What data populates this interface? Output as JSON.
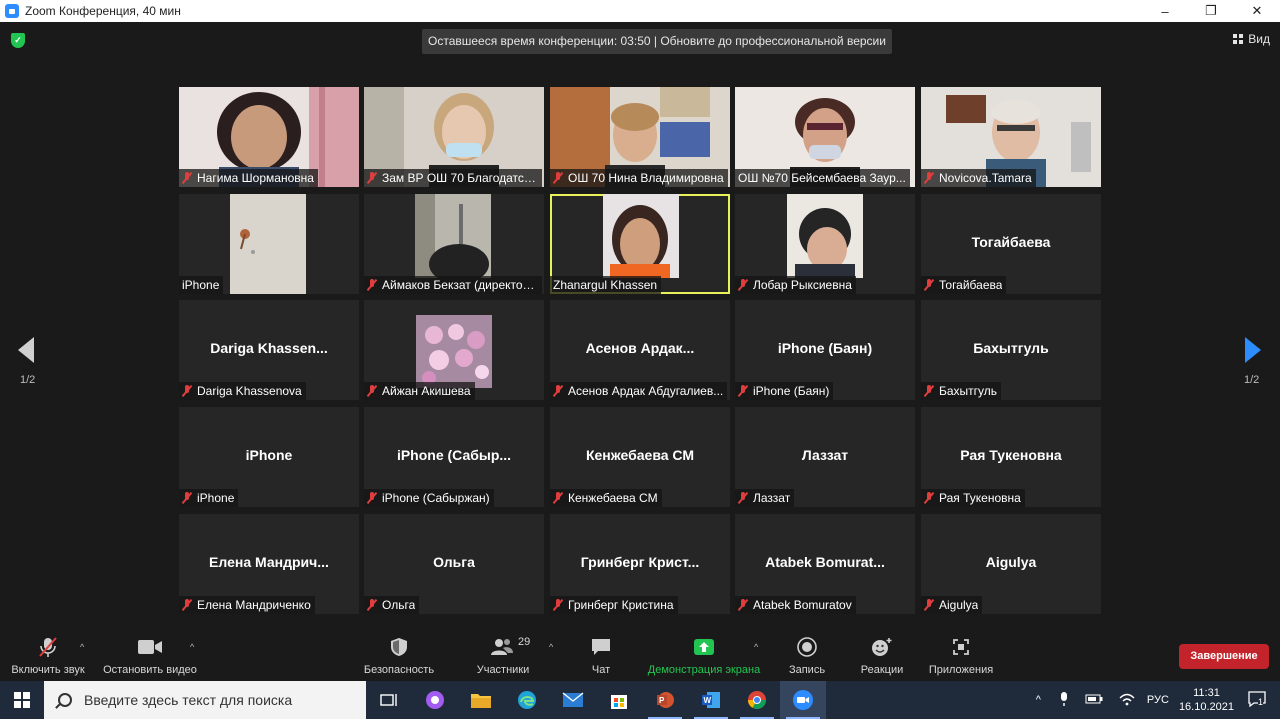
{
  "window": {
    "title": "Zoom Конференция, 40 мин",
    "controls": [
      "–",
      "❐",
      "✕"
    ]
  },
  "top": {
    "banner": "Оставшееся время конференции: 03:50 | Обновите до профессиональной версии",
    "view_label": "Вид"
  },
  "pager": {
    "left": "1/2",
    "right": "1/2"
  },
  "tiles": [
    {
      "name": "Нагима Шормановна",
      "big": "",
      "muted": true,
      "video": "woman-dark-hair-curtain"
    },
    {
      "name": "Зам ВР ОШ 70 Благодатск...",
      "big": "",
      "muted": true,
      "video": "young-woman-mask"
    },
    {
      "name": "ОШ 70 Нина Владимировна",
      "big": "",
      "muted": true,
      "video": "woman-office-shelves"
    },
    {
      "name": "ОШ №70 Бейсембаева Заур...",
      "big": "",
      "muted": false,
      "video": "woman-glasses-mask"
    },
    {
      "name": "Novicova.Tamara",
      "big": "",
      "muted": true,
      "video": "woman-glasses-room"
    },
    {
      "name": "iPhone",
      "big": "",
      "muted": false,
      "video": "ceiling-phone"
    },
    {
      "name": "Аймаков Бекзат (директор...",
      "big": "",
      "muted": true,
      "video": "man-window"
    },
    {
      "name": "Zhanargul Khassen",
      "big": "",
      "muted": false,
      "video": "woman-orange",
      "active": true
    },
    {
      "name": "Лобар Рыксиевна",
      "big": "",
      "muted": true,
      "video": "woman-hand-head"
    },
    {
      "name": "Тогайбаева",
      "big": "Тогайбаева",
      "muted": true
    },
    {
      "name": "Dariga Khassenova",
      "big": "Dariga  Khassen...",
      "muted": true
    },
    {
      "name": "Айжан Акишева",
      "big": "",
      "muted": true,
      "video": "pink-flowers"
    },
    {
      "name": "Асенов Ардак Абдугалиев...",
      "big": "Асенов  Ардак...",
      "muted": true
    },
    {
      "name": "iPhone (Баян)",
      "big": "iPhone (Баян)",
      "muted": true
    },
    {
      "name": "Бахытгуль",
      "big": "Бахытгуль",
      "muted": true
    },
    {
      "name": "iPhone",
      "big": "iPhone",
      "muted": true
    },
    {
      "name": "iPhone (Сабыржан)",
      "big": "iPhone  (Сабыр...",
      "muted": true
    },
    {
      "name": "Кенжебаева СМ",
      "big": "Кенжебаева СМ",
      "muted": true
    },
    {
      "name": "Лаззат",
      "big": "Лаззат",
      "muted": true
    },
    {
      "name": "Рая Тукеновна",
      "big": "Рая Тукеновна",
      "muted": true
    },
    {
      "name": "Елена Мандриченко",
      "big": "Елена  Мандрич...",
      "muted": true
    },
    {
      "name": "Ольга",
      "big": "Ольга",
      "muted": true
    },
    {
      "name": "Гринберг Кристина",
      "big": "Гринберг  Крист...",
      "muted": true
    },
    {
      "name": "Atabek Bomuratov",
      "big": "Atabek  Bomurat...",
      "muted": true
    },
    {
      "name": "Aigulya",
      "big": "Aigulya",
      "muted": true
    }
  ],
  "toolbar": {
    "unmute": "Включить звук",
    "start_video": "Остановить видео",
    "security": "Безопасность",
    "participants": "Участники",
    "participants_count": "29",
    "chat": "Чат",
    "share_screen": "Демонстрация экрана",
    "record": "Запись",
    "reactions": "Реакции",
    "apps": "Приложения",
    "end": "Завершение",
    "share_color": "#23c552",
    "end_color": "#c3242b"
  },
  "taskbar": {
    "search_placeholder": "Введите здесь текст для поиска",
    "lang": "РУС",
    "time": "11:31",
    "date": "16.10.2021",
    "notifications": "1"
  }
}
